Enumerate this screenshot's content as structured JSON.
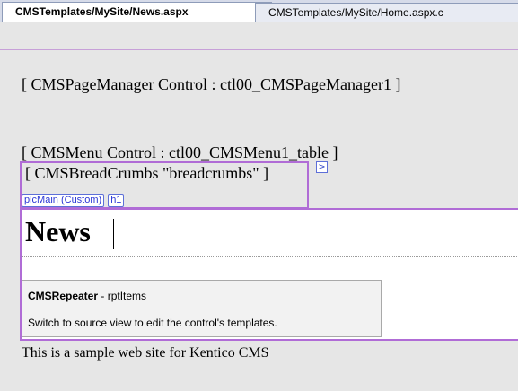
{
  "tabs": [
    {
      "label": "CMSTemplates/MySite/News.aspx",
      "active": true
    },
    {
      "label": "CMSTemplates/MySite/Home.aspx.c",
      "active": false
    }
  ],
  "designer": {
    "page_manager": "[ CMSPageManager Control : ctl00_CMSPageManager1 ]",
    "menu": "[ CMSMenu Control : ctl00_CMSMenu1_table ]",
    "breadcrumbs": "[ CMSBreadCrumbs \"breadcrumbs\" ]",
    "breadcrumbs_arrow": ">",
    "zone_badge": "plcMain (Custom)",
    "tag_badge": "h1",
    "heading": "News",
    "repeater_name": "CMSRepeater",
    "repeater_id": " - rptItems",
    "repeater_hint": "Switch to source view to edit the control's templates.",
    "footer": "This is a sample web site for Kentico CMS"
  },
  "colors": {
    "zone_border": "#b06cd6",
    "badge_text": "#2b37d6",
    "canvas": "#e6e6e6"
  }
}
